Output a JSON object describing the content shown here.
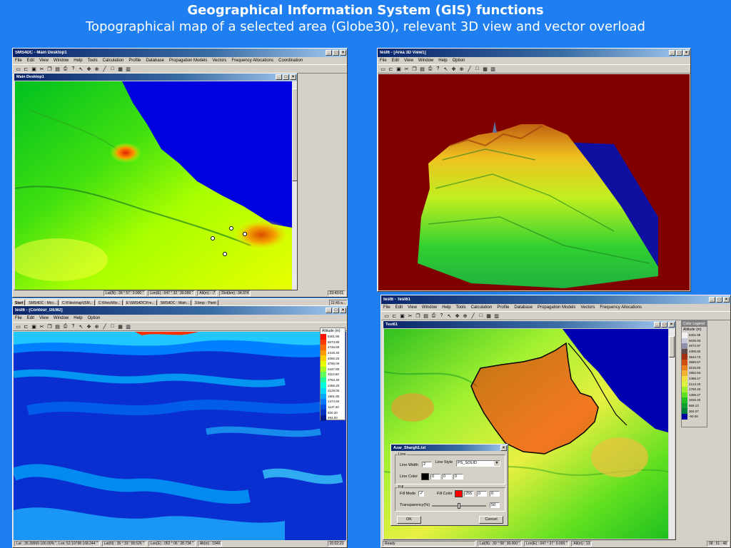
{
  "slide": {
    "title": "Geographical Information System (GIS) functions",
    "subtitle": "Topographical map of a selected area (Globe30), relevant 3D view and vector overload"
  },
  "menus": {
    "main_app": [
      "File",
      "Edit",
      "View",
      "Window",
      "Help",
      "Tools",
      "Calculation",
      "Profile",
      "Database",
      "Propagation Models",
      "Vectors",
      "Frequency Allocations",
      "Coordination"
    ],
    "short": [
      "File",
      "Edit",
      "View",
      "Window",
      "Help",
      "Option"
    ],
    "test61": [
      "File",
      "Edit",
      "View",
      "Window",
      "Help",
      "Tools",
      "Calculation",
      "Profile",
      "Database",
      "Propagation Models",
      "Vectors",
      "Frequency Allocations"
    ]
  },
  "window_tl": {
    "title": "SMS4DC - Main Desktop1",
    "child_title": "Main Desktop1",
    "status": [
      "Lat(N) : 39 ° 57 ' 0.000 \"",
      "Lon(E) : 047 ° 32 ' 30.000 \"",
      "Alt(m) : -7",
      "Dist(km) : 34.974",
      "23:43:01"
    ]
  },
  "taskbar": {
    "start": "Start",
    "tasks": [
      "SMS4DC - Micr...",
      "C:\\Files\\map\\(SM...",
      "C:\\Files\\Wiz...",
      "E:\\SMS4DC\\Fre...",
      "SMS4DC - Main...",
      "3.bmp - Paint"
    ],
    "clock": "11:43 a..."
  },
  "window_tr": {
    "title": "test6 - [Area 3D View1]"
  },
  "window_bl": {
    "title": "test6 - [Contour_DEM2]",
    "legend_title": "Altitude (m)",
    "legend": [
      {
        "value": "5401.90",
        "color": "#ff1000"
      },
      {
        "value": "5073.80",
        "color": "#ff3a00"
      },
      {
        "value": "4746.60",
        "color": "#ff6a00"
      },
      {
        "value": "4419.40",
        "color": "#ff9a00"
      },
      {
        "value": "4092.20",
        "color": "#ffd000"
      },
      {
        "value": "3765.00",
        "color": "#e8ff00"
      },
      {
        "value": "3437.80",
        "color": "#a8ff20"
      },
      {
        "value": "3110.60",
        "color": "#60ff60"
      },
      {
        "value": "2783.40",
        "color": "#20ffa0"
      },
      {
        "value": "2456.20",
        "color": "#00ffe0"
      },
      {
        "value": "2129.00",
        "color": "#00d8ff"
      },
      {
        "value": "1801.80",
        "color": "#00a8ff"
      },
      {
        "value": "1474.60",
        "color": "#0078ff"
      },
      {
        "value": "1147.40",
        "color": "#0050e0"
      },
      {
        "value": "820.20",
        "color": "#0030c0"
      },
      {
        "value": "493.00",
        "color": "#001890"
      }
    ],
    "status": [
      "Lat : 35.39999 100.00% \", Lon: 52.10798 168.244 \"",
      "Lat(N) : 35 ° 33 ' 58.526 \"",
      "Lon(E) : 052 ° 06 ' 28.734 \"",
      "Alt(m) : 1946",
      "15:02:23"
    ]
  },
  "window_br": {
    "title": "test6 - Test61",
    "child_title": "Test61",
    "legend_title": "Color Legend",
    "legend_subtitle": "Altitude (m)",
    "legend": [
      {
        "value": "5401.99",
        "color": "#f2f2f2"
      },
      {
        "value": "5035.93",
        "color": "#c8c8d8"
      },
      {
        "value": "4672.97",
        "color": "#9090a8"
      },
      {
        "value": "4306.80",
        "color": "#604848"
      },
      {
        "value": "3944.73",
        "color": "#a03010"
      },
      {
        "value": "3580.67",
        "color": "#d05010"
      },
      {
        "value": "3216.60",
        "color": "#e88020"
      },
      {
        "value": "2852.53",
        "color": "#f0b030"
      },
      {
        "value": "2488.47",
        "color": "#f0e040"
      },
      {
        "value": "2124.40",
        "color": "#e0f040"
      },
      {
        "value": "1760.33",
        "color": "#a0f030"
      },
      {
        "value": "1396.27",
        "color": "#60e020"
      },
      {
        "value": "1032.20",
        "color": "#20c020"
      },
      {
        "value": "668.13",
        "color": "#10a030"
      },
      {
        "value": "304.07",
        "color": "#008040"
      },
      {
        "value": "-60.00",
        "color": "#0000a0"
      }
    ],
    "status": [
      "Ready",
      "Lat(N) : 39 ° 58 ' 30.000 \"",
      "Lon(E) : 047 ° 27 ' 0.000 \"",
      "Alt(m) : 13",
      "08 : 51 : 48"
    ]
  },
  "dialog": {
    "title": "Azar_Shargh1.txt",
    "line_group": "Line",
    "line_width_label": "Line Width",
    "line_width_value": "2",
    "line_style_label": "Line Style",
    "line_style_value": "PS_SOLID",
    "line_color_label": "Line Color",
    "line_color_r": "0",
    "line_color_g": "0",
    "line_color_b": "0",
    "fill_group": "Fill",
    "fill_mode_label": "Fill Mode",
    "fill_mode_checked": true,
    "fill_color_label": "Fill Color",
    "fill_color_r": "255",
    "fill_color_g": "0",
    "fill_color_b": "0",
    "transparency_label": "Transparency(%)",
    "transparency_value": "50",
    "ok_label": "OK",
    "cancel_label": "Cancel",
    "line_color": "#000000",
    "fill_color": "#ff0000"
  },
  "toolbar_icons": [
    "new-icon",
    "open-icon",
    "save-icon",
    "cut-icon",
    "copy-icon",
    "paste-icon",
    "print-icon",
    "help-icon",
    "pointer-icon",
    "pan-icon",
    "zoom-icon",
    "line-icon",
    "rectangle-icon",
    "colormap-icon",
    "legend-icon"
  ]
}
